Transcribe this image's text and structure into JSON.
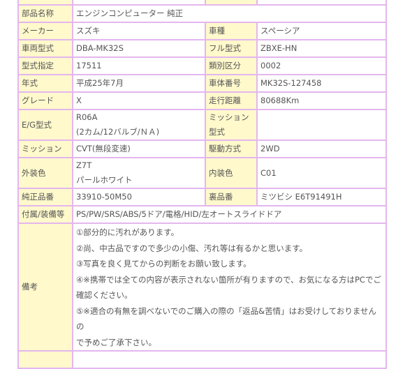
{
  "rows": {
    "part_name": {
      "label": "部品名称",
      "value": "エンジンコンピューター 純正"
    },
    "maker": {
      "label": "メーカー",
      "value": "スズキ",
      "label2": "車種",
      "value2": "スペーシア"
    },
    "vehicle_model": {
      "label": "車両型式",
      "value": "DBA-MK32S",
      "label2": "フル型式",
      "value2": "ZBXE-HN"
    },
    "model_designation": {
      "label": "型式指定",
      "value": "17511",
      "label2": "類別区分",
      "value2": "0002"
    },
    "year": {
      "label": "年式",
      "value": "平成25年7月",
      "label2": "車体番号",
      "value2": "MK32S-127458"
    },
    "grade": {
      "label": "グレード",
      "value": "X",
      "label2": "走行距離",
      "value2": "80688Km"
    },
    "engine": {
      "label": "E/G型式",
      "value_line1": "R06A",
      "value_line2": "(2カム/12バルブ/ＮＡ)",
      "label2": "ミッション型式",
      "value2": ""
    },
    "transmission": {
      "label": "ミッション",
      "value": "CVT(無段変速)",
      "label2": "駆動方式",
      "value2": "2WD"
    },
    "exterior": {
      "label": "外装色",
      "value_line1": "Z7T",
      "value_line2": "パールホワイト",
      "label2": "内装色",
      "value2": "C01"
    },
    "part_number": {
      "label": "純正品番",
      "value": "33910-50M50",
      "label2": "裏品番",
      "value2": "ミツビシ E6T91491H"
    },
    "equipment": {
      "label": "付属/装備等",
      "value": "PS/PW/SRS/ABS/5ドア/電格/HID/左オートスライドドア"
    },
    "notes": {
      "label": "備考",
      "lines": [
        "①部分的に汚れがあります。",
        "②尚、中古品ですので多少の小傷、汚れ等は有るかと思います。",
        "③写真を良く見てからの判断をお願い致します。",
        "④※携帯では全ての内容が表示されない箇所が有りますので、お気になる方はPCでご",
        "確認ください。",
        "⑤※適合の有無を調べないでのご購入の際の「返品&苦情」はお受けしておりませんの",
        "で予めご了承下さい。"
      ]
    }
  }
}
